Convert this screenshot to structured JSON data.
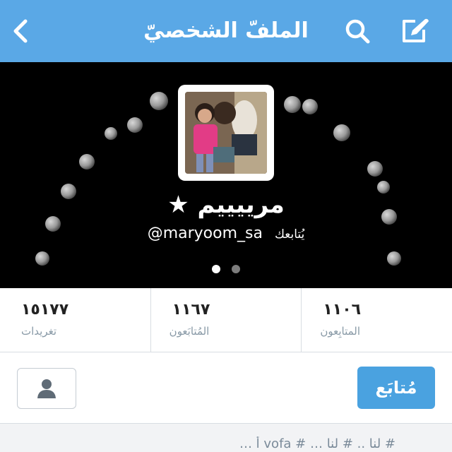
{
  "nav": {
    "title": "الملفّ الشخصيّ",
    "back_icon": "chevron-left-icon",
    "search_icon": "search-icon",
    "compose_icon": "compose-icon"
  },
  "profile": {
    "display_name": "مرييييم ★",
    "handle": "@maryoom_sa",
    "follows_you": "يُتابعك",
    "page_dots": 2,
    "active_dot": 1
  },
  "stats": [
    {
      "number": "١٥١٧٧",
      "label": "تغريدات"
    },
    {
      "number": "١١٦٧",
      "label": "المُتابَعون"
    },
    {
      "number": "١١٠٦",
      "label": "المتابِعون"
    }
  ],
  "actions": {
    "follow_label": "مُتابَع",
    "user_icon": "user-icon"
  },
  "bottom": {
    "preview_text": "# لنا .. # لنا …  # vofa  أ …"
  },
  "colors": {
    "nav_bg": "#5aa8e6",
    "header_bg": "#000000",
    "follow_btn": "#4aa2e0",
    "label_gray": "#8899a6"
  }
}
